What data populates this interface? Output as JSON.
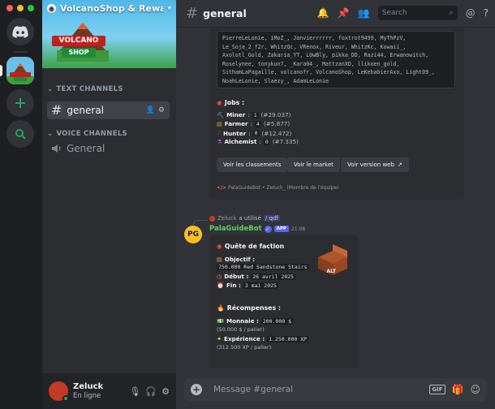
{
  "window": {
    "traffic_colors": [
      "#ff5f57",
      "#febc2e",
      "#28c840"
    ]
  },
  "server": {
    "name": "VolcanoShop & Rewa...",
    "logo_line1": "VOLCANO",
    "logo_line2": "SHOP",
    "rail_logo_line1": "VOLCANO",
    "rail_logo_line2": "SHOP"
  },
  "sidebar": {
    "text_category": "TEXT CHANNELS",
    "voice_category": "VOICE CHANNELS",
    "text_channels": [
      {
        "name": "general",
        "active": true
      }
    ],
    "voice_channels": [
      {
        "name": "General"
      }
    ]
  },
  "user": {
    "name": "Zeluck",
    "status": "En ligne"
  },
  "header": {
    "channel": "general",
    "search_placeholder": "Search"
  },
  "stats_embed": {
    "players": "PierreLeLonie, iMoZ_, Janvierrrrrr, foxtrot9499, MyThPzV, Le_Soja_2_f2r, WhitzQc, VRenox, Riveur, WhitzKc, Kowaii_, Axolotl_Gold, Zakaria_YT, L0wBly, pikka_DD, Razi44, Erwanowitch, Roselynee, tonykun7, _Kara04_, MattzanXD, llikoen_gold, SithamLaPagaille, volcanofr, VolcanoShop, LeKebabierAxo, Light09_, NoahLeLonie, Slaezy_, AdamLeLonie",
    "jobs_title": "Jobs :",
    "jobs": [
      {
        "name": "Miner",
        "level": "1",
        "rank": "(#29.037)"
      },
      {
        "name": "Farmer",
        "level": "4",
        "rank": "(#5.877)"
      },
      {
        "name": "Hunter",
        "level": "0",
        "rank": "(#12.472)"
      },
      {
        "name": "Alchemist",
        "level": "0",
        "rank": "(#7.335)"
      }
    ],
    "buttons": [
      "Voir les classements",
      "Voir le market",
      "Voir version web"
    ],
    "footer": "PalaGuideBot • Zeluck_ (Membre de l'équipe)"
  },
  "reply": {
    "user": "Zeluck",
    "text": "a utilisé",
    "command": "/ qdf"
  },
  "bot_message": {
    "name": "PalaGuideBot",
    "badge": "APP",
    "time": "21:08",
    "avatar_text": "PG",
    "title": "Quête de faction",
    "objective_label": "Objectif :",
    "objective_value": "750.000 Red Sandstone Stairs",
    "thumb_label": "ALT",
    "start_label": "Début :",
    "start_value": "26 avril 2025",
    "end_label": "Fin :",
    "end_value": "3 mai 2025",
    "rewards_title": "Récompenses :",
    "money_label": "Monnaie :",
    "money_value": "200.000 $",
    "money_sub": "(50.000 $ / palier)",
    "xp_label": "Expérience :",
    "xp_value": "1.250.000 XP",
    "xp_sub": "(312.500 XP / palier)"
  },
  "composer": {
    "placeholder": "Message #general"
  }
}
